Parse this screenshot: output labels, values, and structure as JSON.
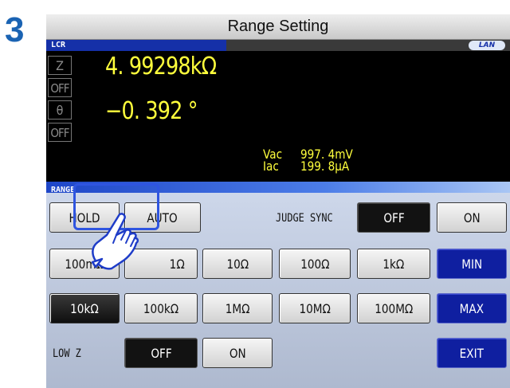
{
  "step_number": "3",
  "title": "Range Setting",
  "header": {
    "mode": "LCR",
    "lan": "LAN"
  },
  "measurement": {
    "param1": "Z",
    "value1": "4. 99298kΩ",
    "param2": "OFF",
    "param3": "θ",
    "value3": "−0. 392  °",
    "param4": "OFF",
    "vac_label": "Vac",
    "vac_value": "997. 4mV",
    "iac_label": "Iac",
    "iac_value": "199. 8μA"
  },
  "range_section": "RANGE",
  "buttons": {
    "hold": "HOLD",
    "auto": "AUTO",
    "judge_sync_label": "JUDGE SYNC",
    "judge_off": "OFF",
    "judge_on": "ON",
    "r100m": "100mΩ",
    "r1": "1Ω",
    "r10": "10Ω",
    "r100": "100Ω",
    "r1k": "1kΩ",
    "min": "MIN",
    "r10k": "10kΩ",
    "r100k": "100kΩ",
    "r1M": "1MΩ",
    "r10M": "10MΩ",
    "r100M": "100MΩ",
    "max": "MAX",
    "low_z_label": "LOW Z",
    "low_z_off": "OFF",
    "low_z_on": "ON",
    "exit": "EXIT"
  },
  "icons": {
    "hand": "pointing-hand-icon"
  },
  "colors": {
    "step": "#1a63b3",
    "value": "#ffff3c",
    "accent": "#0f1fa0",
    "highlight": "#2f55e0"
  }
}
